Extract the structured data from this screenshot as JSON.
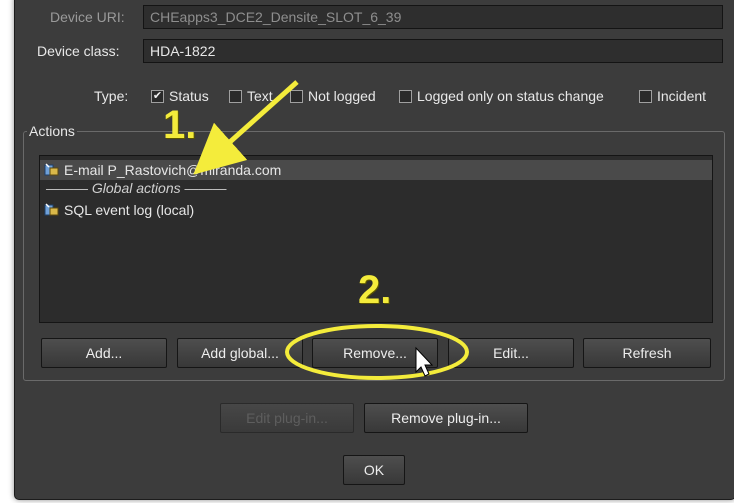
{
  "device_uri": {
    "label": "Device URI:",
    "value": "CHEapps3_DCE2_Densite_SLOT_6_39"
  },
  "device_class": {
    "label": "Device class:",
    "value": "HDA-1822"
  },
  "type": {
    "label": "Type:",
    "options": [
      {
        "label": "Status",
        "checked": true
      },
      {
        "label": "Text",
        "checked": false
      },
      {
        "label": "Not logged",
        "checked": false
      },
      {
        "label": "Logged only on status change",
        "checked": false
      },
      {
        "label": "Incident",
        "checked": false
      }
    ],
    "check_glyph": "✔"
  },
  "actions": {
    "legend": "Actions",
    "items": [
      {
        "label": "E-mail P_Rastovich@miranda.com",
        "icon": "plugin-icon",
        "selected": true
      },
      {
        "label": "——— Global actions ———"
      },
      {
        "label": "SQL event log (local)",
        "icon": "plugin-icon"
      }
    ],
    "buttons": {
      "add": "Add...",
      "add_global": "Add global...",
      "remove": "Remove...",
      "edit": "Edit...",
      "refresh": "Refresh"
    }
  },
  "plugin_buttons": {
    "edit": "Edit plug-in...",
    "remove": "Remove plug-in..."
  },
  "ok": "OK",
  "annotations": {
    "step1": "1.",
    "step2": "2.",
    "color": "#f4ec3b"
  }
}
